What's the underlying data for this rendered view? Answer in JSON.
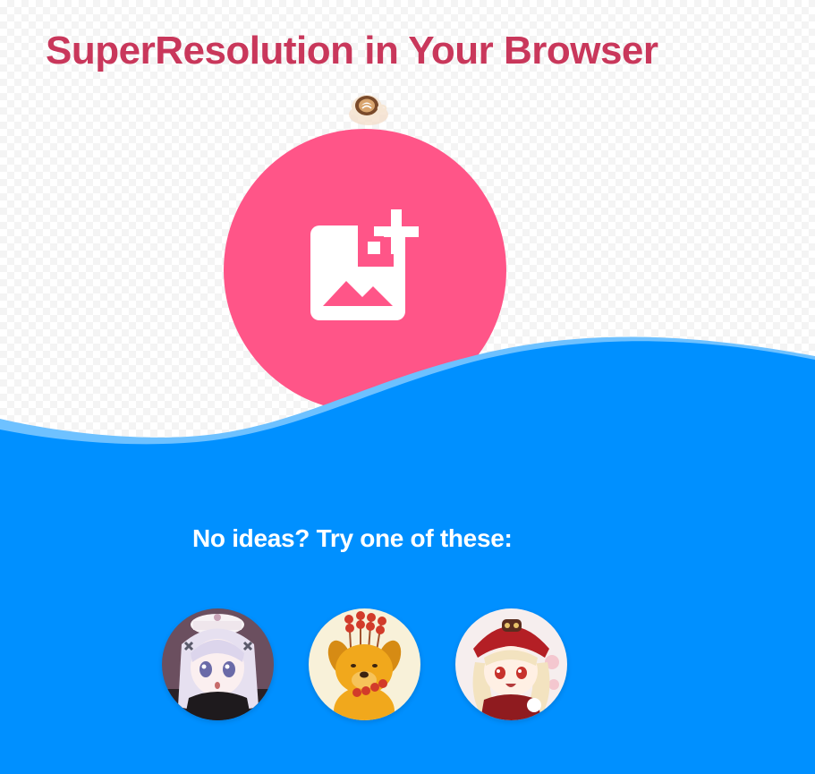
{
  "header": {
    "title": "SuperResolution in Your Browser"
  },
  "upload": {
    "icon": "add-photo-icon"
  },
  "coffee": {
    "icon": "coffee-cup-icon"
  },
  "samples": {
    "heading": "No ideas? Try one of these:",
    "items": [
      {
        "icon": "anime-girl-white-hair-thumbnail"
      },
      {
        "icon": "cartoon-dog-thumbnail"
      },
      {
        "icon": "anime-girl-red-hat-thumbnail"
      }
    ]
  },
  "colors": {
    "title": "#c9375b",
    "upload_circle": "#ff5588",
    "wave": "#0090ff",
    "wave_light": "#6ec1ff",
    "text_on_wave": "#ffffff"
  }
}
